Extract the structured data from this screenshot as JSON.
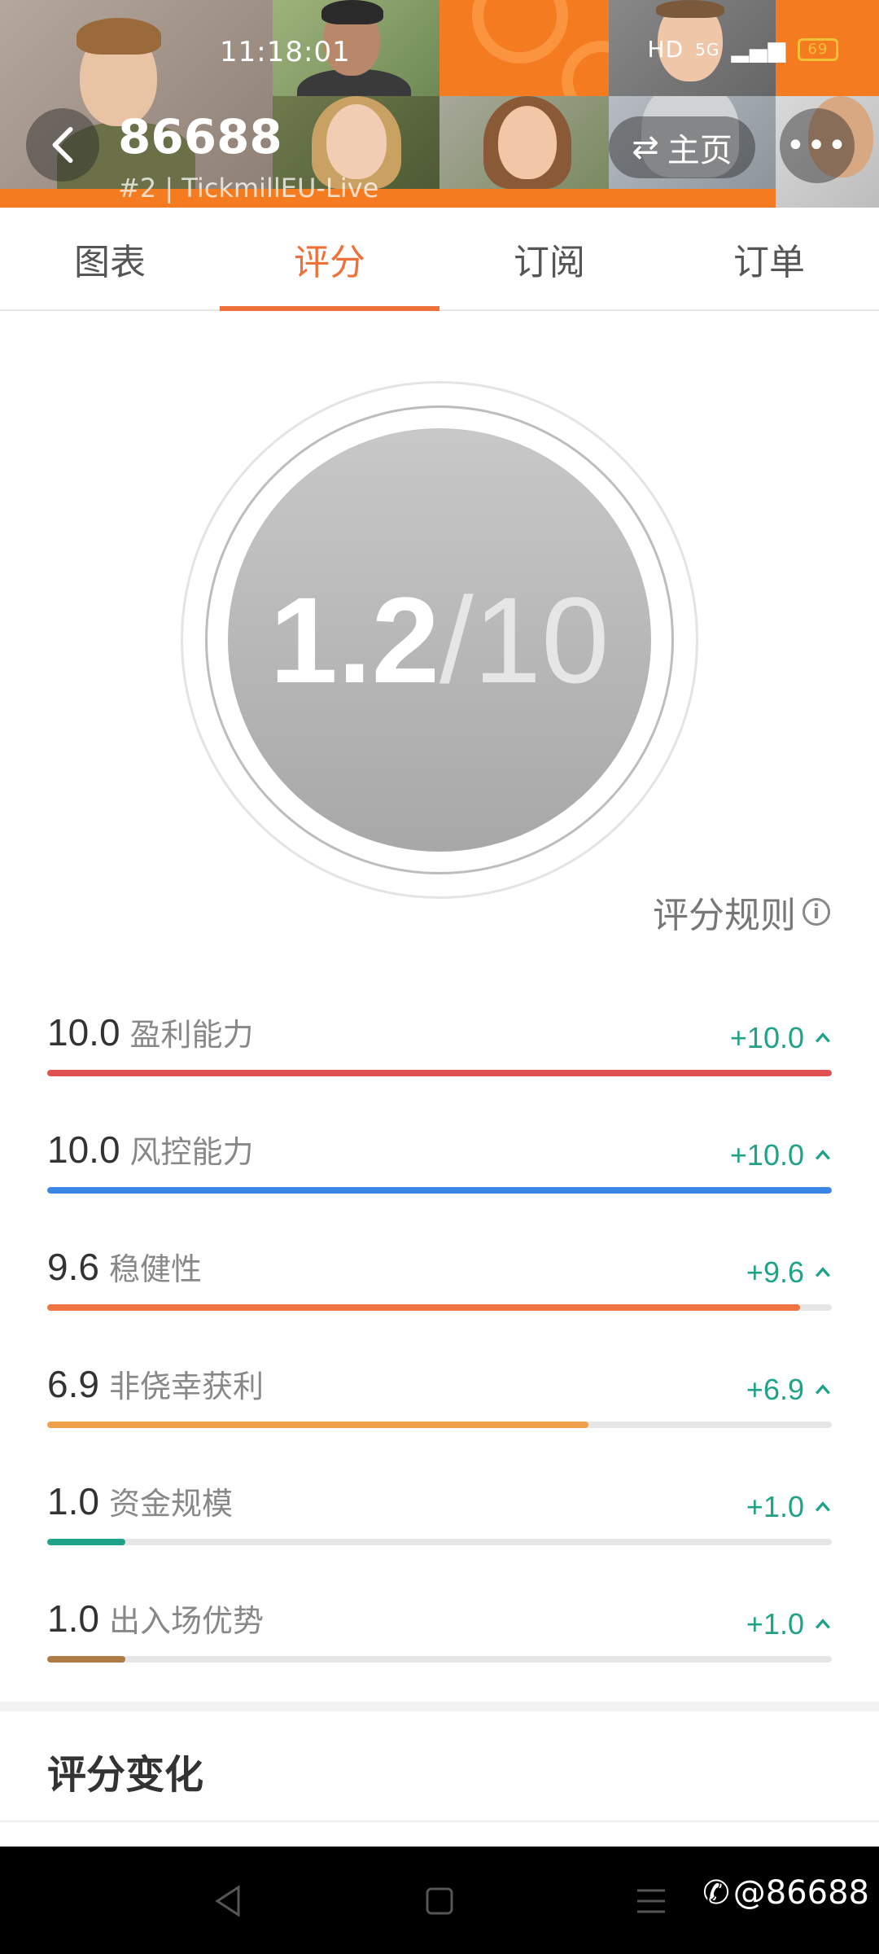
{
  "status_bar": {
    "time": "11:18:01",
    "network": "HD",
    "signal": "5G",
    "battery": "69"
  },
  "header": {
    "title": "86688",
    "subtitle": "#2 | TickmillEU-Live",
    "home_label": "主页",
    "accent_color": "#f47b20"
  },
  "tabs": [
    {
      "label": "图表"
    },
    {
      "label": "评分"
    },
    {
      "label": "订阅"
    },
    {
      "label": "订单"
    }
  ],
  "active_tab": "评分",
  "score": {
    "value": "1.2",
    "separator": "/",
    "total": "10"
  },
  "rules_label": "评分规则",
  "metrics": [
    {
      "value": "10.0",
      "name": "盈利能力",
      "delta": "+10.0",
      "level": 1.0,
      "color": "#e05151"
    },
    {
      "value": "10.0",
      "name": "风控能力",
      "delta": "+10.0",
      "level": 1.0,
      "color": "#3a86e6"
    },
    {
      "value": "9.6",
      "name": "稳健性",
      "delta": "+9.6",
      "level": 0.96,
      "color": "#f07540"
    },
    {
      "value": "6.9",
      "name": "非侥幸获利",
      "delta": "+6.9",
      "level": 0.69,
      "color": "#eea04a"
    },
    {
      "value": "1.0",
      "name": "资金规模",
      "delta": "+1.0",
      "level": 0.1,
      "color": "#1ea388"
    },
    {
      "value": "1.0",
      "name": "出入场优势",
      "delta": "+1.0",
      "level": 0.1,
      "color": "#b07a44"
    }
  ],
  "delta_color": "#1ea388",
  "section_title": "评分变化",
  "watermark": "@86688"
}
